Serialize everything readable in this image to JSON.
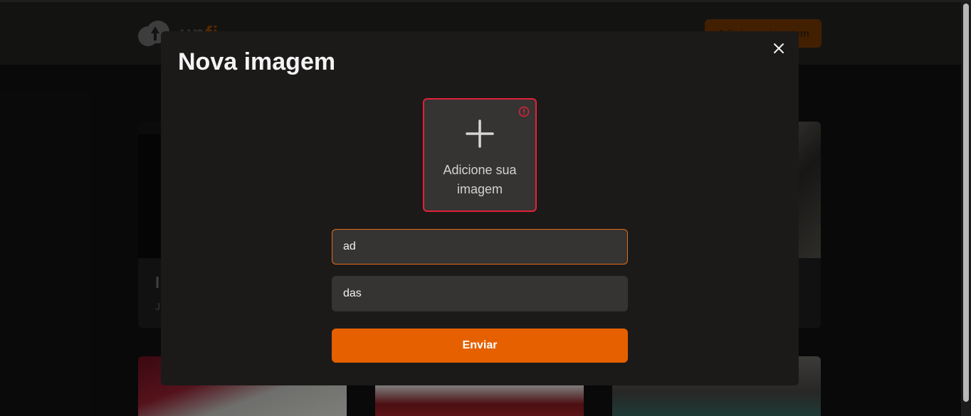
{
  "header": {
    "logo_text_main": "up",
    "logo_text_accent": "fi",
    "add_button_label": "Adicionar imagem"
  },
  "cards": [
    {
      "title": "l",
      "subtitle": "J"
    }
  ],
  "modal": {
    "title": "Nova imagem",
    "upload_label_line1": "Adicione sua",
    "upload_label_line2": "imagem",
    "title_field_value": "ad",
    "description_field_value": "das",
    "submit_label": "Enviar"
  },
  "colors": {
    "accent": "#e66000",
    "error": "#e2213a",
    "modal_bg": "#1b1a19",
    "field_bg": "#353432"
  },
  "icons": [
    "close-icon",
    "plus-icon",
    "warning-icon",
    "logo-icon"
  ]
}
